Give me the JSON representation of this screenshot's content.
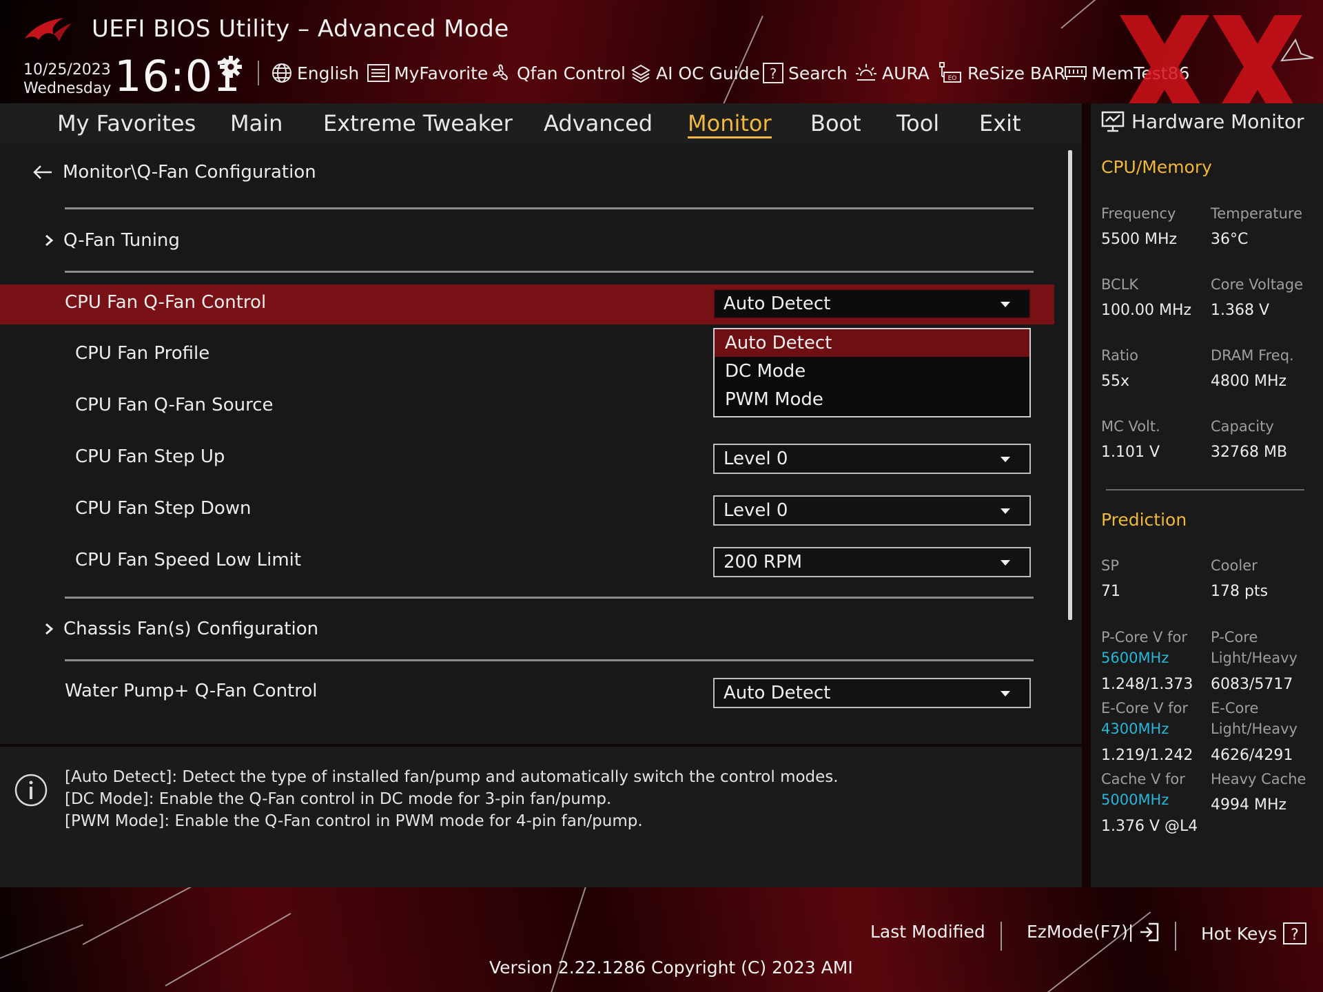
{
  "header": {
    "app_title": "UEFI BIOS Utility – Advanced Mode",
    "date": "10/25/2023",
    "weekday": "Wednesday",
    "time": "16:01"
  },
  "toolbar": {
    "english": "English",
    "myfavorite": "MyFavorite",
    "qfan_control": "Qfan Control",
    "ai_oc_guide": "AI OC Guide",
    "search": "Search",
    "aura": "AURA",
    "resize_bar": "ReSize BAR",
    "memtest": "MemTest86"
  },
  "tabs": [
    {
      "label": "My Favorites"
    },
    {
      "label": "Main"
    },
    {
      "label": "Extreme Tweaker"
    },
    {
      "label": "Advanced"
    },
    {
      "label": "Monitor",
      "active": true
    },
    {
      "label": "Boot"
    },
    {
      "label": "Tool"
    },
    {
      "label": "Exit"
    }
  ],
  "breadcrumb": "Monitor\\Q-Fan Configuration",
  "settings": {
    "qfan_tuning": "Q-Fan Tuning",
    "cpu_fan_qfan_control": {
      "label": "CPU Fan Q-Fan Control",
      "value": "Auto Detect"
    },
    "cpu_fan_profile": {
      "label": "CPU Fan Profile"
    },
    "cpu_fan_qfan_source": {
      "label": "CPU Fan Q-Fan Source"
    },
    "cpu_fan_step_up": {
      "label": "CPU Fan Step Up",
      "value": "Level 0"
    },
    "cpu_fan_step_down": {
      "label": "CPU Fan Step Down",
      "value": "Level 0"
    },
    "cpu_fan_speed_low_limit": {
      "label": "CPU Fan Speed Low Limit",
      "value": "200 RPM"
    },
    "chassis_fans": "Chassis Fan(s) Configuration",
    "water_pump_qfan_control": {
      "label": "Water Pump+ Q-Fan Control",
      "value": "Auto Detect"
    }
  },
  "dropdown_options": [
    "Auto Detect",
    "DC Mode",
    "PWM Mode"
  ],
  "help": [
    "[Auto Detect]: Detect the type of installed fan/pump and automatically switch the control modes.",
    "[DC Mode]: Enable the Q-Fan control in DC mode for 3-pin fan/pump.",
    "[PWM Mode]: Enable the Q-Fan control in PWM mode for 4-pin fan/pump."
  ],
  "hardware_monitor": {
    "title": "Hardware Monitor",
    "cpu_memory_heading": "CPU/Memory",
    "frequency": {
      "label": "Frequency",
      "value": "5500 MHz"
    },
    "temperature": {
      "label": "Temperature",
      "value": "36°C"
    },
    "bclk": {
      "label": "BCLK",
      "value": "100.00 MHz"
    },
    "core_voltage": {
      "label": "Core Voltage",
      "value": "1.368 V"
    },
    "ratio": {
      "label": "Ratio",
      "value": "55x"
    },
    "dram_freq": {
      "label": "DRAM Freq.",
      "value": "4800 MHz"
    },
    "mc_volt": {
      "label": "MC Volt.",
      "value": "1.101 V"
    },
    "capacity": {
      "label": "Capacity",
      "value": "32768 MB"
    },
    "prediction_heading": "Prediction",
    "sp": {
      "label": "SP",
      "value": "71"
    },
    "cooler": {
      "label": "Cooler",
      "value": "178 pts"
    },
    "pcore_v": {
      "label": "P-Core V for",
      "freq": "5600MHz",
      "value": "1.248/1.373"
    },
    "pcore_lh": {
      "label1": "P-Core",
      "label2": "Light/Heavy",
      "value": "6083/5717"
    },
    "ecore_v": {
      "label": "E-Core V for",
      "freq": "4300MHz",
      "value": "1.219/1.242"
    },
    "ecore_lh": {
      "label1": "E-Core",
      "label2": "Light/Heavy",
      "value": "4626/4291"
    },
    "cache_v": {
      "label": "Cache V for",
      "freq": "5000MHz",
      "value": "1.376 V @L4"
    },
    "heavy_cache": {
      "label": "Heavy Cache",
      "value": "4994 MHz"
    }
  },
  "footer": {
    "last_modified": "Last Modified",
    "ezmode": "EzMode(F7)|",
    "hot_keys": "Hot Keys",
    "version": "Version 2.22.1286 Copyright (C) 2023 AMI"
  },
  "colors": {
    "accent": "#f0b83c",
    "selection": "#781217",
    "frequency_text": "#29b6d8",
    "panel": "#181818"
  }
}
